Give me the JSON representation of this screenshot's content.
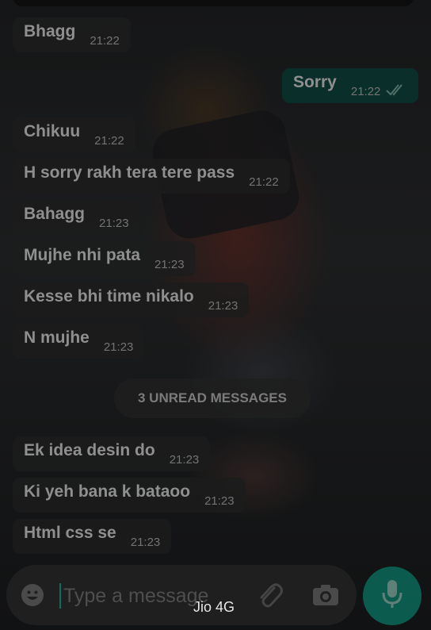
{
  "messages": [
    {
      "text": "Bhagg",
      "time": "21:22",
      "direction": "in"
    },
    {
      "text": "Sorry",
      "time": "21:22",
      "direction": "out",
      "status": "read-double-tick"
    },
    {
      "text": "Chikuu",
      "time": "21:22",
      "direction": "in"
    },
    {
      "text": "H sorry rakh tera tere pass",
      "time": "21:22",
      "direction": "in"
    },
    {
      "text": "Bahagg",
      "time": "21:23",
      "direction": "in"
    },
    {
      "text": "Mujhe nhi pata",
      "time": "21:23",
      "direction": "in"
    },
    {
      "text": "Kesse bhi time nikalo",
      "time": "21:23",
      "direction": "in"
    },
    {
      "text": "N mujhe",
      "time": "21:23",
      "direction": "in"
    },
    {
      "text": "Ek idea desin do",
      "time": "21:23",
      "direction": "in"
    },
    {
      "text": "Ki yeh bana k bataoo",
      "time": "21:23",
      "direction": "in"
    },
    {
      "text": "Html css se",
      "time": "21:23",
      "direction": "in"
    }
  ],
  "unread_banner": {
    "label": "3 UNREAD MESSAGES"
  },
  "composer": {
    "placeholder": "Type a message",
    "value": "",
    "emoji_icon": "emoji-icon",
    "attach_icon": "paperclip-icon",
    "camera_icon": "camera-icon",
    "mic_icon": "microphone-icon"
  },
  "network_toast": {
    "label": "Jio 4G"
  },
  "colors": {
    "accent": "#0b5b4f",
    "outgoing_bubble": "#08342e",
    "incoming_bubble": "#1c1c1c"
  }
}
